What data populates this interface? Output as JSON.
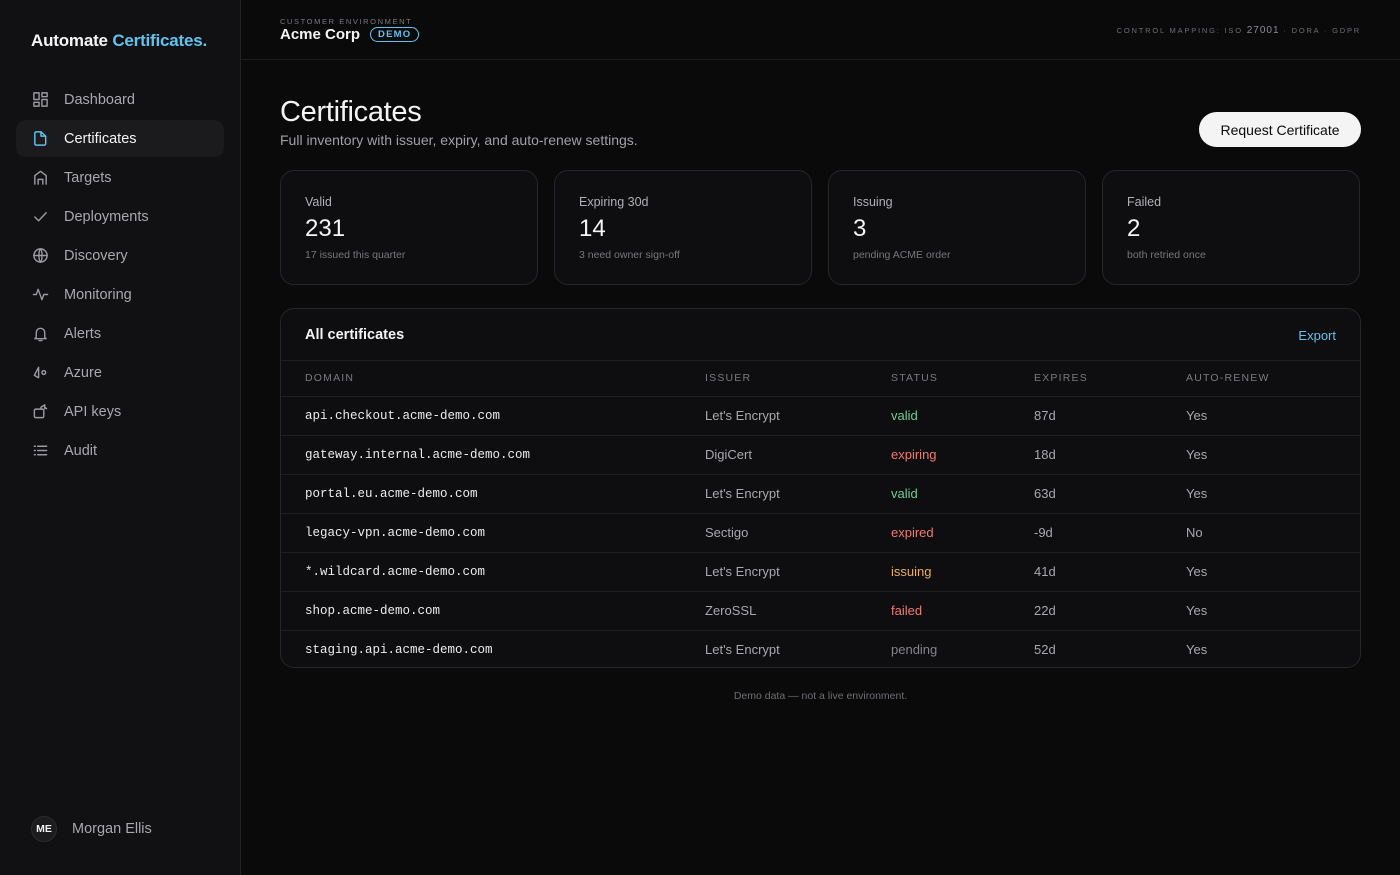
{
  "brand": {
    "part1": "Automate ",
    "part2": "Certificates."
  },
  "colors": {
    "accent": "#5ec4f0",
    "valid": "#6ccf95",
    "danger": "#f07a6e",
    "warning": "#e9b04e",
    "muted": "#84848a"
  },
  "sidebar": {
    "items": [
      {
        "label": "Dashboard",
        "icon": "dashboard-icon"
      },
      {
        "label": "Certificates",
        "icon": "file-icon",
        "active": true
      },
      {
        "label": "Targets",
        "icon": "target-icon"
      },
      {
        "label": "Deployments",
        "icon": "check-icon"
      },
      {
        "label": "Discovery",
        "icon": "globe-icon"
      },
      {
        "label": "Monitoring",
        "icon": "activity-icon"
      },
      {
        "label": "Alerts",
        "icon": "bell-icon"
      },
      {
        "label": "Azure",
        "icon": "azure-icon"
      },
      {
        "label": "API keys",
        "icon": "key-icon"
      },
      {
        "label": "Audit",
        "icon": "list-icon"
      }
    ],
    "user": {
      "initials": "ME",
      "name": "Morgan Ellis"
    }
  },
  "topbar": {
    "env_label": "CUSTOMER ENVIRONMENT",
    "env_name": "Acme Corp",
    "badge": "DEMO",
    "control_prefix": "CONTROL MAPPING: ISO ",
    "control_iso": "27001",
    "control_suffix": " · DORA · GDPR"
  },
  "page": {
    "title": "Certificates",
    "subtitle": "Full inventory with issuer, expiry, and auto-renew settings.",
    "request_button": "Request Certificate"
  },
  "stats": [
    {
      "label": "Valid",
      "value": "231",
      "note": "17 issued this quarter"
    },
    {
      "label": "Expiring 30d",
      "value": "14",
      "note": "3 need owner sign-off"
    },
    {
      "label": "Issuing",
      "value": "3",
      "note": "pending ACME order"
    },
    {
      "label": "Failed",
      "value": "2",
      "note": "both retried once"
    }
  ],
  "table": {
    "title": "All certificates",
    "export": "Export",
    "headers": [
      "DOMAIN",
      "ISSUER",
      "STATUS",
      "EXPIRES",
      "AUTO-RENEW"
    ],
    "rows": [
      {
        "domain": "api.checkout.acme-demo.com",
        "issuer": "Let's Encrypt",
        "status": "valid",
        "expires": "87d",
        "auto_renew": "Yes"
      },
      {
        "domain": "gateway.internal.acme-demo.com",
        "issuer": "DigiCert",
        "status": "expiring",
        "expires": "18d",
        "auto_renew": "Yes"
      },
      {
        "domain": "portal.eu.acme-demo.com",
        "issuer": "Let's Encrypt",
        "status": "valid",
        "expires": "63d",
        "auto_renew": "Yes"
      },
      {
        "domain": "legacy-vpn.acme-demo.com",
        "issuer": "Sectigo",
        "status": "expired",
        "expires": "-9d",
        "auto_renew": "No"
      },
      {
        "domain": "*.wildcard.acme-demo.com",
        "issuer": "Let's Encrypt",
        "status": "issuing",
        "expires": "41d",
        "auto_renew": "Yes"
      },
      {
        "domain": "shop.acme-demo.com",
        "issuer": "ZeroSSL",
        "status": "failed",
        "expires": "22d",
        "auto_renew": "Yes"
      },
      {
        "domain": "staging.api.acme-demo.com",
        "issuer": "Let's Encrypt",
        "status": "pending",
        "expires": "52d",
        "auto_renew": "Yes"
      }
    ]
  },
  "footnote": "Demo data — not a live environment."
}
